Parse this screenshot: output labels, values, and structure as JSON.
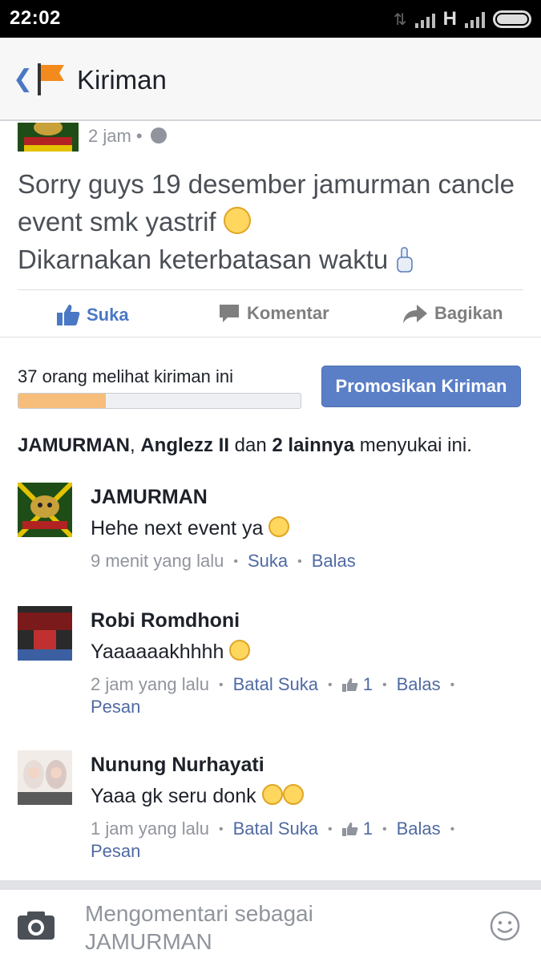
{
  "status_bar": {
    "time": "22:02",
    "network": "H"
  },
  "app_bar": {
    "back_icon": "chevron-left-icon",
    "flag_icon": "flag-icon",
    "title": "Kiriman"
  },
  "post": {
    "time": "2 jam",
    "separator": "•",
    "privacy_icon": "globe-icon",
    "text_line1": "Sorry guys 19 desember jamurman cancle event smk yastrif",
    "text_line2": "Dikarnakan keterbatasan waktu",
    "actions": {
      "like": "Suka",
      "comment": "Komentar",
      "share": "Bagikan"
    }
  },
  "insights": {
    "views_text": "37 orang melihat kiriman ini",
    "progress_fraction": 0.31,
    "promote_button": "Promosikan Kiriman"
  },
  "likes": {
    "name1": "JAMURMAN",
    "sep1": ", ",
    "name2": "Anglezz II",
    "and": " dan ",
    "others": "2 lainnya",
    "suffix": " menyukai ini."
  },
  "comments": [
    {
      "name": "JAMURMAN",
      "text": "Hehe next event ya",
      "time": "9 menit yang lalu",
      "like_label": "Suka",
      "reply_label": "Balas"
    },
    {
      "name": "Robi Romdhoni",
      "text": "Yaaaaaakhhhh",
      "time": "2 jam yang lalu",
      "like_label": "Batal Suka",
      "like_count": "1",
      "reply_label": "Balas",
      "message_label": "Pesan"
    },
    {
      "name": "Nunung Nurhayati",
      "text": "Yaaa gk seru donk",
      "time": "1 jam yang lalu",
      "like_label": "Batal Suka",
      "like_count": "1",
      "reply_label": "Balas",
      "message_label": "Pesan"
    }
  ],
  "composer": {
    "placeholder": "Mengomentari sebagai JAMURMAN",
    "camera_icon": "camera-icon",
    "emoji_icon": "smiley-icon"
  },
  "colors": {
    "accent": "#4a78c4",
    "link": "#4f6aa3",
    "promo": "#5b7fc7",
    "progress_fill": "#f7be7b"
  }
}
